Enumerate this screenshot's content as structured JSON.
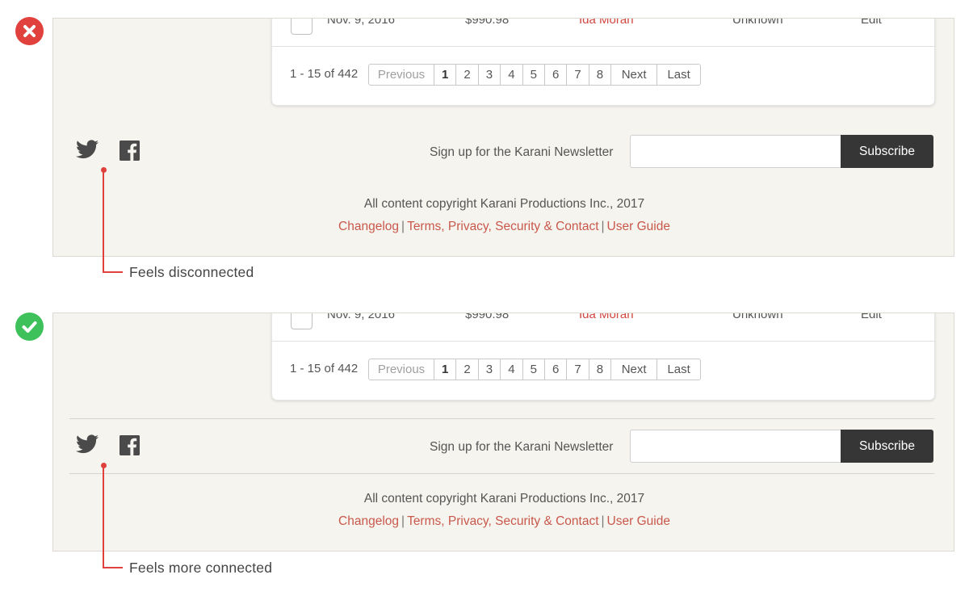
{
  "examples": [
    {
      "status": "bad",
      "status_icon": "x-icon",
      "row": {
        "date": "Nov. 9, 2016",
        "amount": "$990.98",
        "name": "Ida Moran",
        "status": "Unknown",
        "action": "Edit"
      },
      "pagination": {
        "range": "1 - 15 of 442",
        "previous": "Previous",
        "pages": [
          "1",
          "2",
          "3",
          "4",
          "5",
          "6",
          "7",
          "8"
        ],
        "active_page": "1",
        "next": "Next",
        "last": "Last"
      },
      "social_icons": [
        "twitter-icon",
        "facebook-icon"
      ],
      "newsletter": {
        "label": "Sign up for the Karani Newsletter",
        "input_value": "",
        "button": "Subscribe"
      },
      "copyright": "All content copyright Karani Productions Inc., 2017",
      "links": {
        "changelog": "Changelog",
        "terms": "Terms, Privacy, Security & Contact",
        "guide": "User Guide",
        "separator": "|"
      },
      "annotation": "Feels disconnected",
      "accent_color": "#e0413c"
    },
    {
      "status": "good",
      "status_icon": "check-icon",
      "row": {
        "date": "Nov. 9, 2016",
        "amount": "$990.98",
        "name": "Ida Moran",
        "status": "Unknown",
        "action": "Edit"
      },
      "pagination": {
        "range": "1 - 15 of 442",
        "previous": "Previous",
        "pages": [
          "1",
          "2",
          "3",
          "4",
          "5",
          "6",
          "7",
          "8"
        ],
        "active_page": "1",
        "next": "Next",
        "last": "Last"
      },
      "social_icons": [
        "twitter-icon",
        "facebook-icon"
      ],
      "newsletter": {
        "label": "Sign up for the Karani Newsletter",
        "input_value": "",
        "button": "Subscribe"
      },
      "copyright": "All content copyright Karani Productions Inc., 2017",
      "links": {
        "changelog": "Changelog",
        "terms": "Terms, Privacy, Security & Contact",
        "guide": "User Guide",
        "separator": "|"
      },
      "annotation": "Feels more connected",
      "accent_color": "#3ec15a"
    }
  ]
}
